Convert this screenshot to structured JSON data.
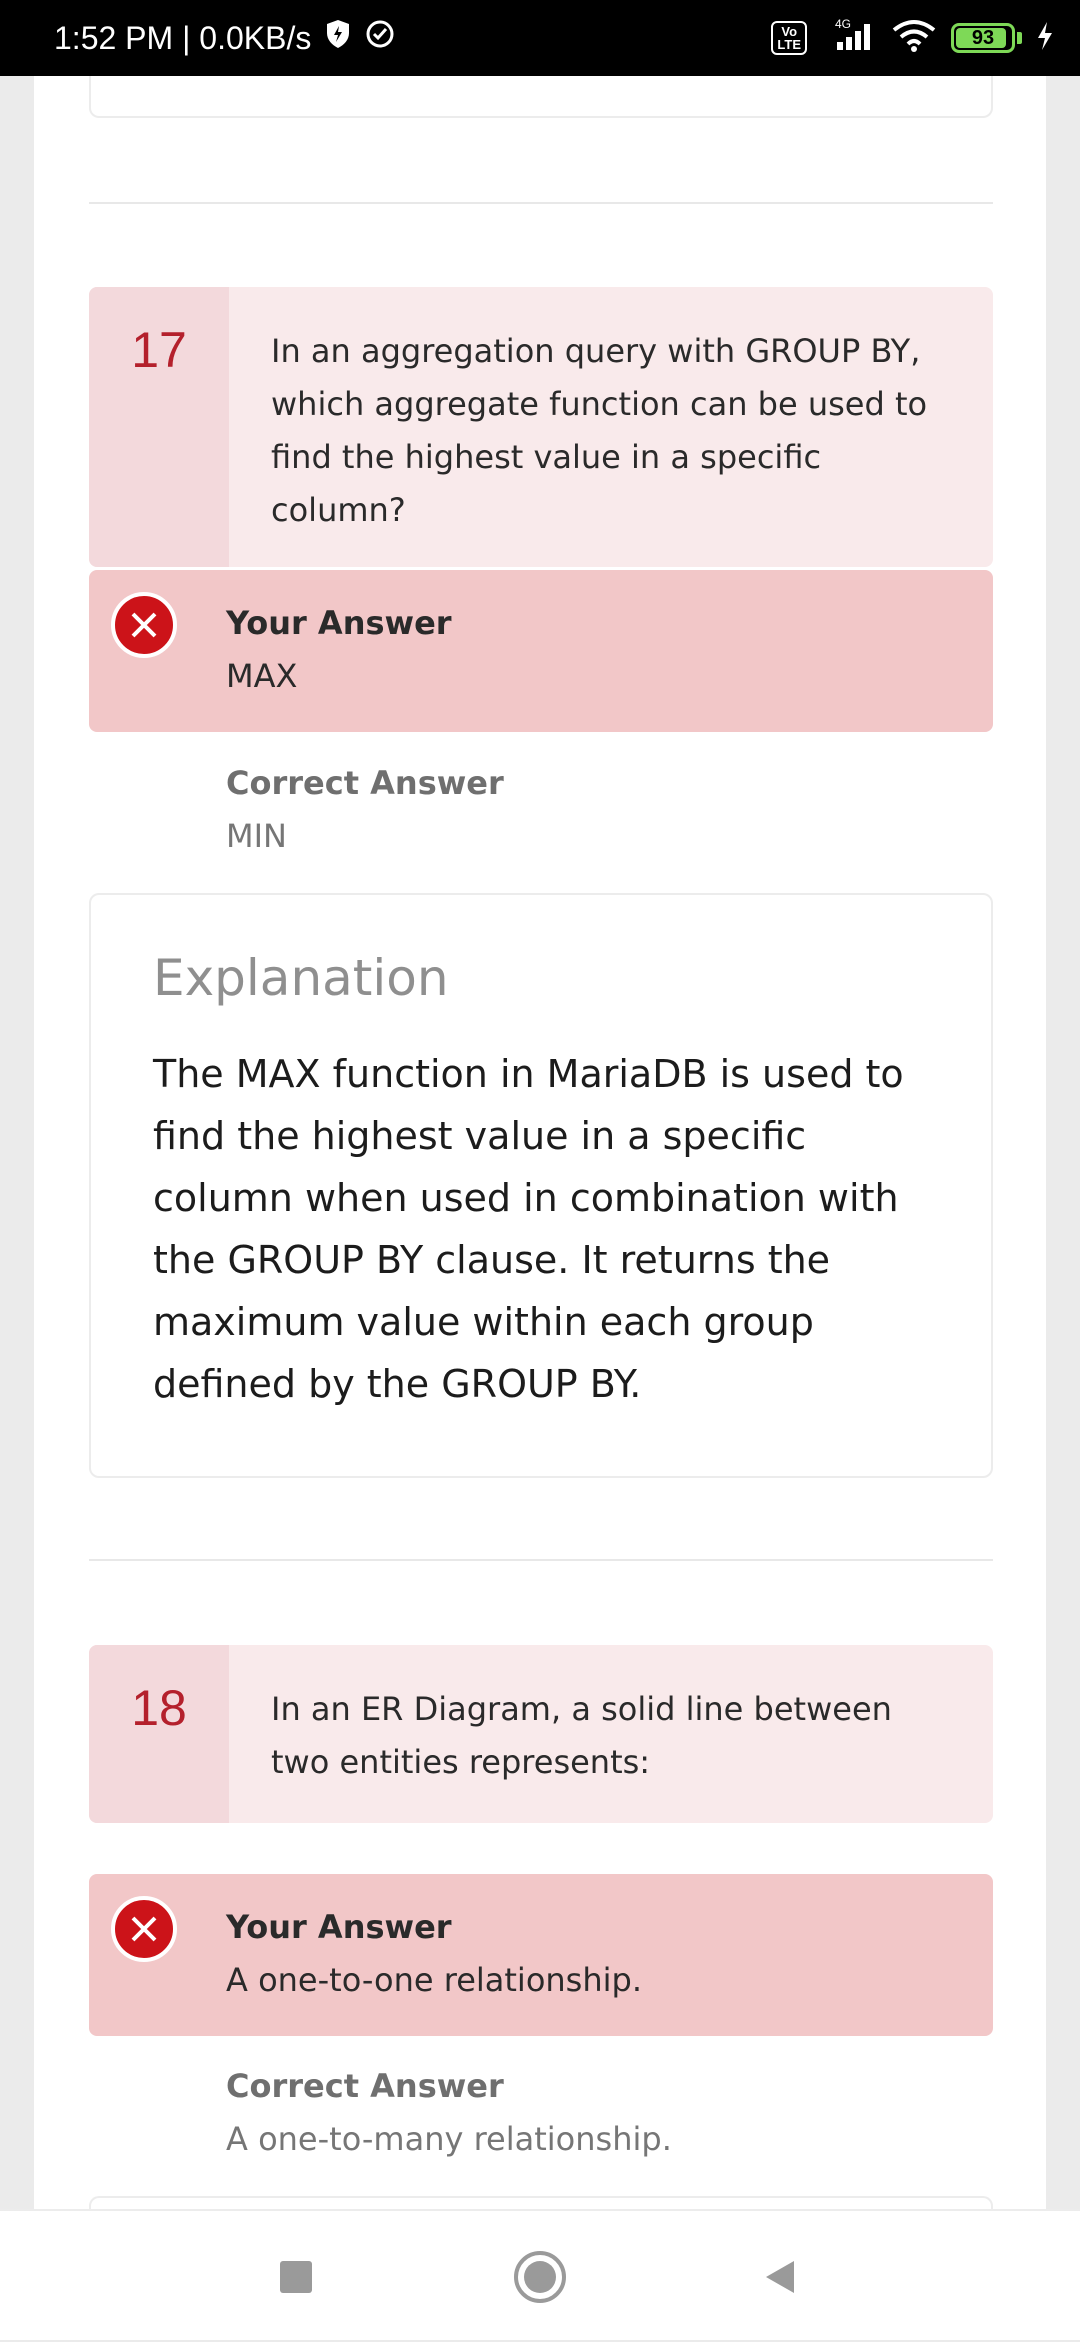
{
  "status_bar": {
    "time": "1:52 PM | 0.0KB/s",
    "network_type": "4G",
    "volte": "Vo\nLTE",
    "battery_level": "93",
    "battery_accent": "#7ed957"
  },
  "questions": [
    {
      "number": "17",
      "text": "In an aggregation query with GROUP BY, which aggregate function can be used to find the highest value in a specific column?",
      "your_answer_label": "Your Answer",
      "your_answer": "MAX",
      "correct_answer_label": "Correct Answer",
      "correct_answer": "MIN",
      "explanation_title": "Explanation",
      "explanation": "The MAX function in MariaDB is used to find the highest value in a specific column when used in combination with the GROUP BY clause. It returns the maximum value within each group defined by the GROUP BY."
    },
    {
      "number": "18",
      "text": "In an ER Diagram, a solid line between two entities represents:",
      "your_answer_label": "Your Answer",
      "your_answer": "A one-to-one relationship.",
      "correct_answer_label": "Correct Answer",
      "correct_answer": "A one-to-many relationship."
    }
  ],
  "colors": {
    "wrong": "#cc1319",
    "answer_bg": "#f2c7c8",
    "question_bg": "#f9eaeb",
    "number_color": "#b4202c"
  },
  "nav": {
    "recent_icon": "square-icon",
    "home_icon": "circle-icon",
    "back_icon": "triangle-back-icon"
  }
}
